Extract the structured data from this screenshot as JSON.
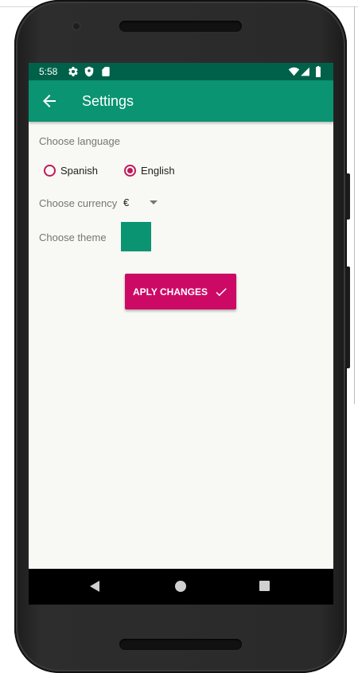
{
  "status_bar": {
    "time": "5:58",
    "icons_left": [
      "settings-gear-icon",
      "shield-icon",
      "sd-card-icon"
    ],
    "icons_right": [
      "wifi-icon",
      "cell-signal-icon",
      "battery-icon"
    ]
  },
  "app_bar": {
    "title": "Settings",
    "back_icon": "arrow-back-icon"
  },
  "settings": {
    "language_label": "Choose language",
    "language_options": [
      {
        "label": "Spanish",
        "checked": false
      },
      {
        "label": "English",
        "checked": true
      }
    ],
    "currency_label": "Choose currency",
    "currency_value": "€",
    "theme_label": "Choose theme",
    "theme_color": "#0a9472"
  },
  "apply_button": {
    "label": "APLY CHANGES",
    "icon": "check-icon",
    "color": "#cc0a66"
  },
  "nav_bar": {
    "icons": [
      "back-triangle-icon",
      "home-circle-icon",
      "recents-square-icon"
    ]
  },
  "colors": {
    "status_bar": "#00614a",
    "app_bar": "#0a9472",
    "accent": "#c2185b"
  }
}
